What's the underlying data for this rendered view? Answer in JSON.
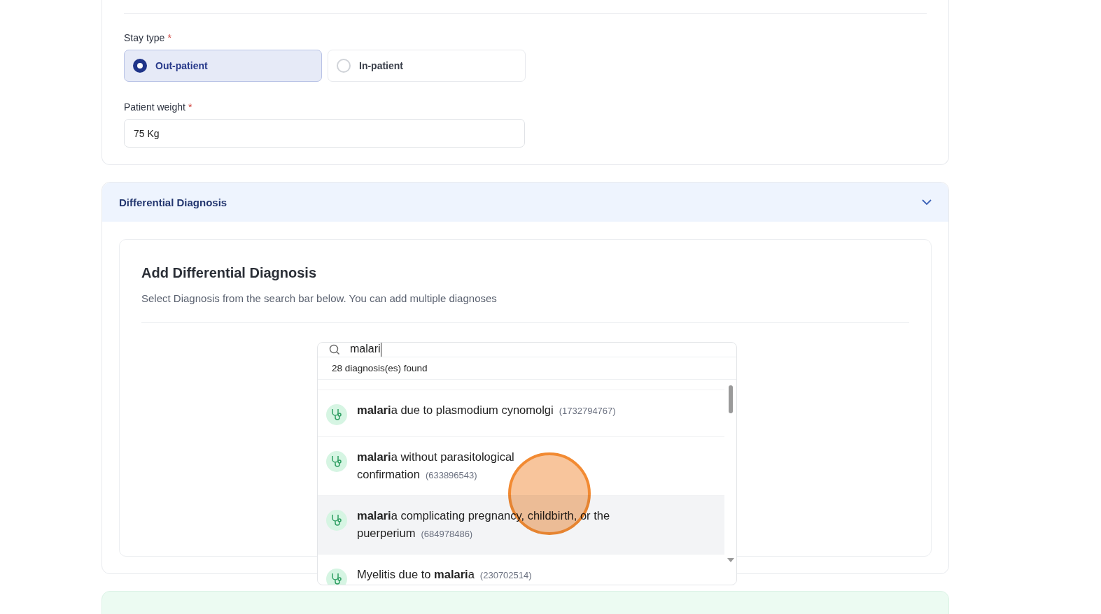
{
  "stay_type": {
    "label": "Stay type",
    "required_mark": "*",
    "options": [
      {
        "label": "Out-patient",
        "selected": true
      },
      {
        "label": "In-patient",
        "selected": false
      }
    ]
  },
  "patient_weight": {
    "label": "Patient weight",
    "required_mark": "*",
    "value": "75 Kg"
  },
  "differential_diagnosis": {
    "title": "Differential Diagnosis",
    "expanded": true,
    "heading": "Add Differential Diagnosis",
    "description": "Select Diagnosis from the search bar below. You can add multiple diagnoses",
    "search": {
      "value": "malari",
      "count": "28 diagnosis(es) found",
      "results": [
        {
          "name": "**malari**a due to plasmodium cynomolgi",
          "code": "(1732794767)",
          "hovered": false
        },
        {
          "name": "**malari**a without parasitological confirmation",
          "code": "(633896543)",
          "hovered": false
        },
        {
          "name": "**malari**a complicating pregnancy, childbirth, or the puerperium",
          "code": "(684978486)",
          "hovered": true
        },
        {
          "name": "Myelitis due to **malari**a",
          "code": "(230702514)",
          "hovered": false
        }
      ]
    }
  }
}
